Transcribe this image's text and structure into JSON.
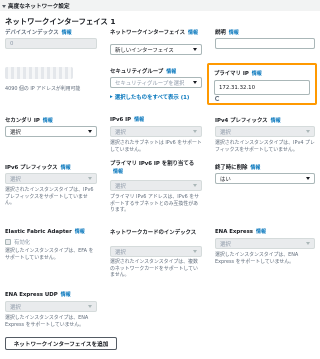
{
  "header": {
    "advanced_label": "高度なネットワーク設定"
  },
  "section_title": "ネットワークインターフェイス 1",
  "info": "情報",
  "device_index": {
    "label": "デバイスインデックス",
    "value": "0"
  },
  "network_interface": {
    "label": "ネットワークインターフェイス",
    "value": "新しいインターフェイス"
  },
  "description": {
    "label": "説明",
    "value": ""
  },
  "subnet_help": "4090 個の IP アドレスが利用可能",
  "security_group": {
    "label": "セキュリティグループ",
    "placeholder": "セキュリティグループを選択",
    "show_selected": "選択したものをすべて表示 (1)"
  },
  "primary_ip": {
    "label": "プライマリ IP",
    "value": "172.31.32.10"
  },
  "secondary_ip": {
    "label": "セカンダリ IP",
    "value": "選択"
  },
  "ipv6_ip": {
    "label": "IPv6 IP",
    "value": "選択",
    "help": "選択されたサブネットは IPv6 をサポートしていません。"
  },
  "ipv4_prefix": {
    "label": "IPv4 プレフィックス",
    "value": "選択",
    "help": "選択されたインスタンスタイプは、IPv4 プレフィックスをサポートしていません。"
  },
  "ipv6_prefix": {
    "label": "IPv6 プレフィックス",
    "value": "選択",
    "help": "選択されたインスタンスタイプは、IPv6 プレフィックスをサポートしていません。"
  },
  "primary_ipv6": {
    "label": "プライマリ IPv6 IP を割り当てる",
    "value": "選択",
    "help": "プライマリ IPv6 アドレスは、IPv6 をサポートするサブネットとのみ互換性があります。"
  },
  "delete_on_termination": {
    "label": "終了時に削除",
    "value": "はい"
  },
  "efa": {
    "label": "Elastic Fabric Adapter",
    "checkbox": "有効化",
    "help": "選択したインスタンスタイプは、EFA をサポートしていません。"
  },
  "network_card_index": {
    "label": "ネットワークカードのインデックス",
    "value": "選択",
    "help": "選択されたインスタンスタイプは、複数のネットワークカードをサポートしていません。"
  },
  "ena_express": {
    "label": "ENA Express",
    "value": "選択",
    "help": "選択したインスタンスタイプは、ENA Express をサポートしていません。"
  },
  "ena_express_udp": {
    "label": "ENA Express UDP",
    "value": "選択",
    "help": "選択したインスタンスタイプは、ENA Express をサポートしていません。"
  },
  "add_button": "ネットワークインターフェイスを追加",
  "colors": {
    "accent": "#0073bb",
    "highlight": "#ff9900"
  }
}
